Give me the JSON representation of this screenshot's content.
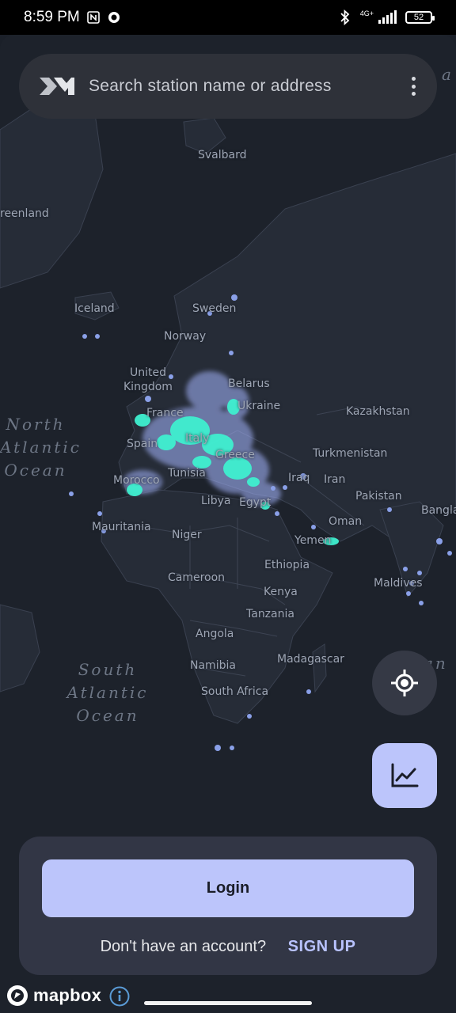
{
  "status_bar": {
    "time": "8:59 PM",
    "network": "4G+",
    "battery": "52"
  },
  "search": {
    "placeholder": "Search station name or address",
    "logo_icon": "app-logo-icon",
    "menu_icon": "more-vertical-icon"
  },
  "map": {
    "countries": [
      "Svalbard",
      "reenland",
      "Iceland",
      "Sweden",
      "Norway",
      "United",
      "Kingdom",
      "Belarus",
      "France",
      "Ukraine",
      "Kazakhstan",
      "Spain",
      "Italy",
      "Greece",
      "Turkmenistan",
      "Tunisia",
      "Morocco",
      "Iraq",
      "Iran",
      "Libya",
      "Egypt",
      "Pakistan",
      "Bangla",
      "Mauritania",
      "Niger",
      "Oman",
      "Yemen",
      "Ethiopia",
      "Cameroon",
      "Kenya",
      "Maldives",
      "Tanzania",
      "Angola",
      "Madagascar",
      "Namibia",
      "South Africa"
    ],
    "oceans": {
      "north_atlantic": [
        "North",
        "Atlantic",
        "Ocean"
      ],
      "south_atlantic": [
        "South",
        "Atlantic",
        "Ocean"
      ],
      "edge_right_top": "a",
      "edge_right_mid": [
        "an",
        "n"
      ]
    },
    "accent_color": "#3ff0d0"
  },
  "buttons": {
    "locate_icon": "locate-icon",
    "chart_icon": "chart-icon"
  },
  "auth": {
    "login_label": "Login",
    "no_account_text": "Don't have an account?",
    "signup_label": "SIGN UP"
  },
  "attribution": {
    "brand": "mapbox",
    "info_icon": "info-icon"
  }
}
